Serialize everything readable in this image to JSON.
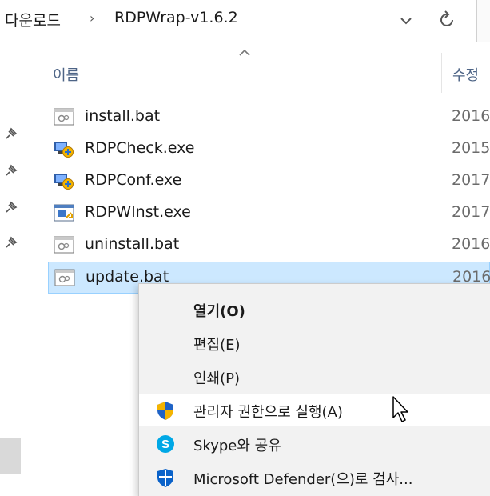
{
  "address_bar": {
    "breadcrumb": [
      "다운로드",
      "RDPWrap-v1.6.2"
    ],
    "separator": "›",
    "icons": [
      "chevron-down-icon",
      "refresh-icon"
    ]
  },
  "columns": {
    "name": "이름",
    "date": "수정"
  },
  "files": [
    {
      "name": "install.bat",
      "date": "2016",
      "icon": "batch-file-icon"
    },
    {
      "name": "RDPCheck.exe",
      "date": "2015",
      "icon": "remote-desktop-exe-icon"
    },
    {
      "name": "RDPConf.exe",
      "date": "2017",
      "icon": "remote-desktop-exe-icon"
    },
    {
      "name": "RDPWInst.exe",
      "date": "2017",
      "icon": "installer-exe-icon"
    },
    {
      "name": "uninstall.bat",
      "date": "2016",
      "icon": "batch-file-icon"
    },
    {
      "name": "update.bat",
      "date": "2016",
      "icon": "batch-file-icon",
      "selected": true
    }
  ],
  "context_menu": {
    "items": [
      {
        "label": "열기(O)",
        "bold": true
      },
      {
        "label": "편집(E)"
      },
      {
        "label": "인쇄(P)"
      },
      {
        "label": "관리자 권한으로 실행(A)",
        "icon": "uac-shield-icon",
        "hover": true
      },
      {
        "label": "Skype와 공유",
        "icon": "skype-icon"
      },
      {
        "label": "Microsoft Defender(으)로 검사...",
        "icon": "defender-icon"
      }
    ]
  },
  "colors": {
    "selection_bg": "#cce8ff",
    "selection_border": "#99d1ff",
    "header_text": "#4d6486",
    "menu_bg": "#f2f2f2"
  }
}
